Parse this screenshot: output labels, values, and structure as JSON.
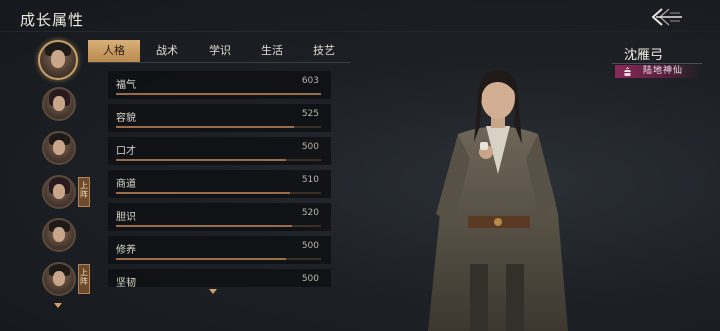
{
  "header": {
    "title": "成长属性",
    "back_icon": "back-arrow-icon"
  },
  "avatars": [
    {
      "state": "active",
      "deployed_badge": ""
    },
    {
      "state": "normal",
      "deployed_badge": ""
    },
    {
      "state": "normal",
      "deployed_badge": ""
    },
    {
      "state": "normal",
      "deployed_badge": "上阵"
    },
    {
      "state": "normal",
      "deployed_badge": ""
    },
    {
      "state": "normal",
      "deployed_badge": "上阵"
    }
  ],
  "tabs": [
    {
      "label": "人格",
      "active": true
    },
    {
      "label": "战术",
      "active": false
    },
    {
      "label": "学识",
      "active": false
    },
    {
      "label": "生活",
      "active": false
    },
    {
      "label": "技艺",
      "active": false
    }
  ],
  "attributes": [
    {
      "name": "福气",
      "value": "603",
      "fill": 1.0
    },
    {
      "name": "容貌",
      "value": "525",
      "fill": 0.87
    },
    {
      "name": "口才",
      "value": "500",
      "fill": 0.83
    },
    {
      "name": "商道",
      "value": "510",
      "fill": 0.85
    },
    {
      "name": "胆识",
      "value": "520",
      "fill": 0.86
    },
    {
      "name": "修养",
      "value": "500",
      "fill": 0.83
    },
    {
      "name": "坚韧",
      "value": "500",
      "fill": 0.83
    }
  ],
  "character": {
    "name": "沈雁弓",
    "rank": "陆地神仙",
    "rank_color": "#8a2a58"
  },
  "colors": {
    "accent": "#c9a165",
    "bar_fill": "#9a6d4a"
  }
}
